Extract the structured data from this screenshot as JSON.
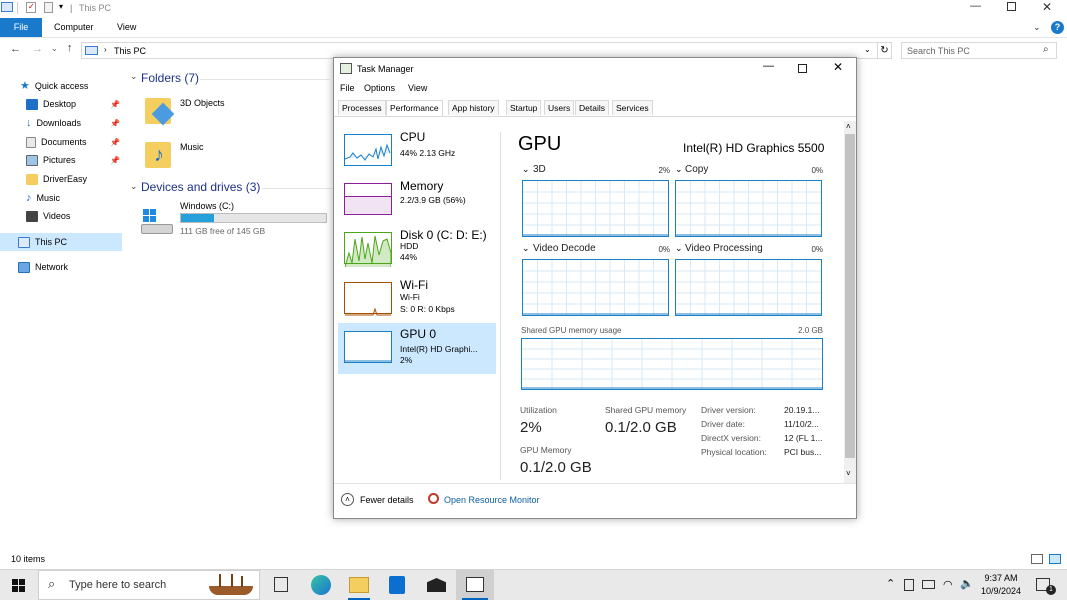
{
  "explorer": {
    "title": "This PC",
    "ribbon_tabs": [
      "File",
      "Computer",
      "View"
    ],
    "address": "This PC",
    "search_placeholder": "Search This PC",
    "nav": {
      "quick_access": "Quick access",
      "items": [
        "Desktop",
        "Downloads",
        "Documents",
        "Pictures",
        "DriverEasy",
        "Music",
        "Videos"
      ],
      "this_pc": "This PC",
      "network": "Network"
    },
    "folders_header": "Folders (7)",
    "folders": [
      "3D Objects",
      "Music"
    ],
    "devices_header": "Devices and drives (3)",
    "drive": {
      "name": "Windows (C:)",
      "free_text": "111 GB free of 145 GB",
      "used_fraction": 0.23
    },
    "status": "10 items"
  },
  "taskmanager": {
    "title": "Task Manager",
    "menu": [
      "File",
      "Options",
      "View"
    ],
    "tabs": [
      "Processes",
      "Performance",
      "App history",
      "Startup",
      "Users",
      "Details",
      "Services"
    ],
    "active_tab": "Performance",
    "sidebar": [
      {
        "title": "CPU",
        "sub1": "44% 2.13 GHz",
        "sub2": "",
        "sub3": "",
        "color": "#1a7fc7"
      },
      {
        "title": "Memory",
        "sub1": "2.2/3.9 GB (56%)",
        "sub2": "",
        "sub3": "",
        "color": "#8b1e9b"
      },
      {
        "title": "Disk 0 (C: D: E:)",
        "sub1": "HDD",
        "sub2": "44%",
        "sub3": "",
        "color": "#4ca619"
      },
      {
        "title": "Wi-Fi",
        "sub1": "Wi-Fi",
        "sub2": "S: 0 R: 0 Kbps",
        "sub3": "",
        "color": "#a74f01"
      },
      {
        "title": "GPU 0",
        "sub1": "Intel(R) HD Graphi...",
        "sub2": "2%",
        "sub3": "",
        "color": "#1a7fc7"
      }
    ],
    "gpu": {
      "heading": "GPU",
      "model": "Intel(R) HD Graphics 5500",
      "engines": [
        {
          "name": "3D",
          "pct": "2%"
        },
        {
          "name": "Copy",
          "pct": "0%"
        },
        {
          "name": "Video Decode",
          "pct": "0%"
        },
        {
          "name": "Video Processing",
          "pct": "0%"
        }
      ],
      "shared_label": "Shared GPU memory usage",
      "shared_max": "2.0 GB",
      "utilization_label": "Utilization",
      "utilization": "2%",
      "shared_mem_label": "Shared GPU memory",
      "shared_mem": "0.1/2.0 GB",
      "gpu_mem_label": "GPU Memory",
      "gpu_mem": "0.1/2.0 GB",
      "details": [
        {
          "k": "Driver version:",
          "v": "20.19.1..."
        },
        {
          "k": "Driver date:",
          "v": "11/10/2..."
        },
        {
          "k": "DirectX version:",
          "v": "12 (FL 1..."
        },
        {
          "k": "Physical location:",
          "v": "PCI bus..."
        }
      ]
    },
    "fewer_details": "Fewer details",
    "resource_monitor": "Open Resource Monitor"
  },
  "taskbar": {
    "search_placeholder": "Type here to search",
    "time": "9:37 AM",
    "date": "10/9/2024",
    "notification_count": "1"
  },
  "colors": {
    "accent": "#1a7fc7",
    "file_tab": "#1979ca",
    "selection": "#cce8ff",
    "drive_bar": "#26a0da"
  }
}
